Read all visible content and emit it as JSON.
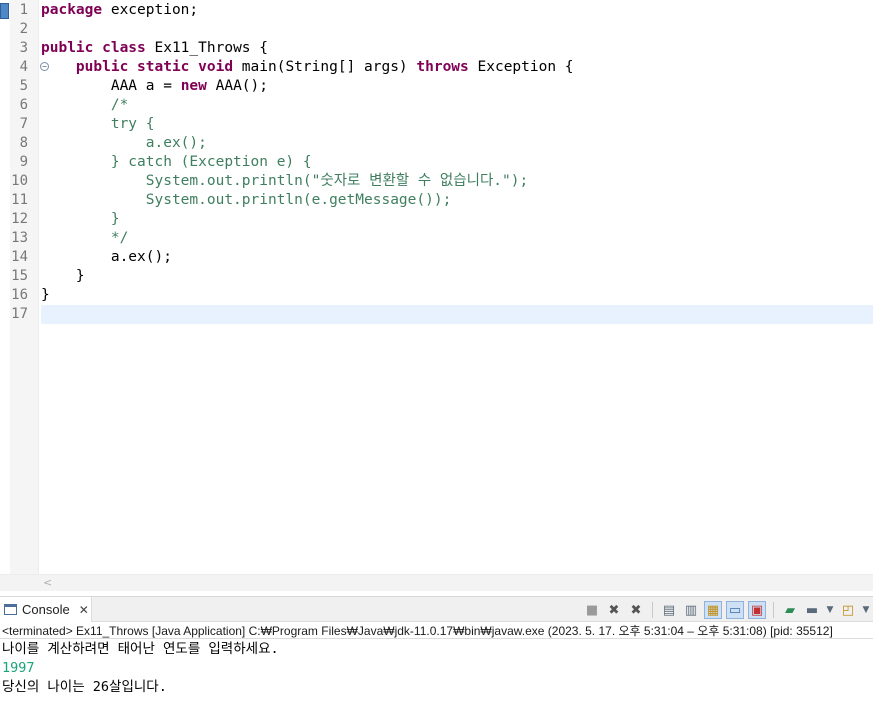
{
  "editor": {
    "line_numbers": [
      "1",
      "2",
      "3",
      "4",
      "5",
      "6",
      "7",
      "8",
      "9",
      "10",
      "11",
      "12",
      "13",
      "14",
      "15",
      "16",
      "17"
    ],
    "lines": {
      "l1_kw": "package",
      "l1_rest": " exception;",
      "l3_kw": "public class",
      "l3_rest": " Ex11_Throws {",
      "l4_indent": "    ",
      "l4_kw": "public static void",
      "l4_mid": " main(String[] args) ",
      "l4_kw2": "throws",
      "l4_rest": " Exception {",
      "l5_pre": "        AAA a = ",
      "l5_kw": "new",
      "l5_rest": " AAA();",
      "l6": "        /*",
      "l7": "        try {",
      "l8": "            a.ex();",
      "l9": "        } catch (Exception e) {",
      "l10": "            System.out.println(\"숫자로 변환할 수 없습니다.\");",
      "l11": "            System.out.println(e.getMessage());",
      "l12": "        }",
      "l13": "        */",
      "l14": "        a.ex();",
      "l15": "    }",
      "l16": "}",
      "l17": ""
    }
  },
  "console": {
    "tab_label": "Console",
    "status": "<terminated> Ex11_Throws [Java Application] C:₩Program Files₩Java₩jdk-11.0.17₩bin₩javaw.exe  (2023. 5. 17. 오후 5:31:04 – 오후 5:31:08) [pid: 35512]",
    "output": [
      "나이를 계산하려면 태어난 연도를 입력하세요.",
      "1997",
      "당신의 나이는 26살입니다."
    ]
  },
  "colors": {
    "keyword": "#7f0055",
    "comment": "#3f7f5f",
    "current_line": "#e8f2fe",
    "console_input": "#1aa37a"
  },
  "icons": {
    "fold": "collapse-icon",
    "console": "console-icon",
    "close": "close-icon",
    "toolbar": [
      "terminate-icon",
      "remove-launch-icon",
      "remove-all-terminated-icon",
      "clear-console-icon",
      "scroll-lock-icon",
      "word-wrap-icon",
      "show-console-on-output-icon",
      "show-console-on-error-icon",
      "pin-console-icon",
      "display-selected-console-icon",
      "open-console-icon"
    ]
  }
}
